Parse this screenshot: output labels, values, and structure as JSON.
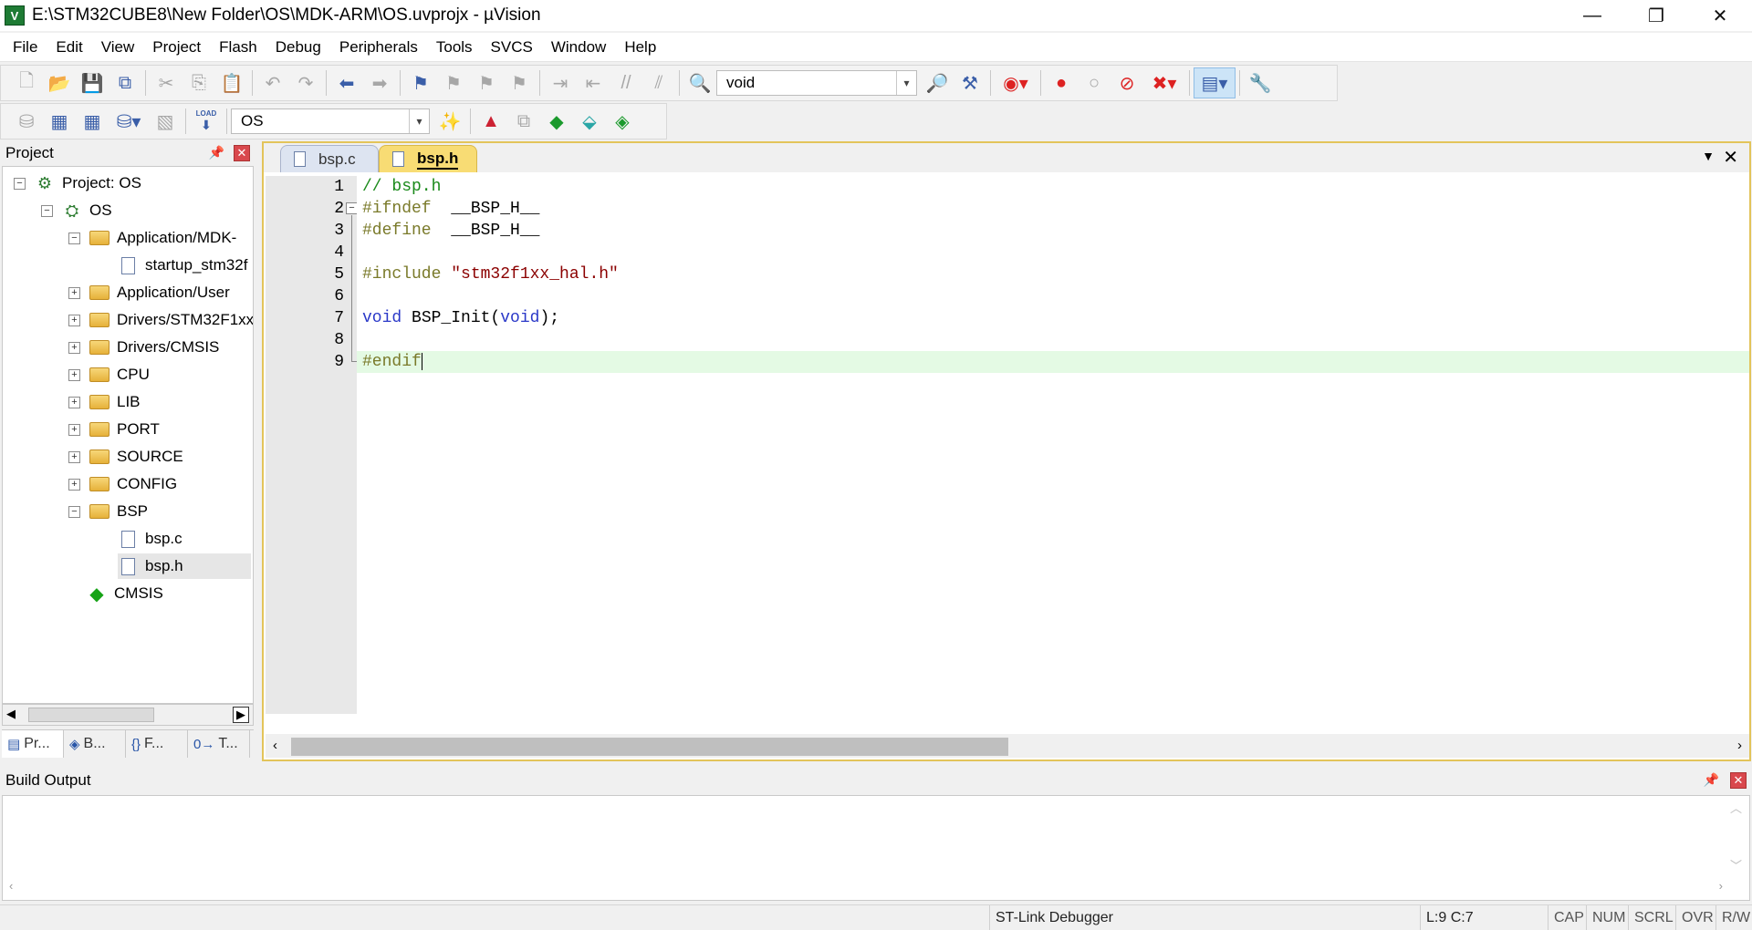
{
  "window": {
    "title": "E:\\STM32CUBE8\\New Folder\\OS\\MDK-ARM\\OS.uvprojx - µVision",
    "app_icon": "V",
    "minimize": "—",
    "restore": "❐",
    "close": "✕"
  },
  "menu": [
    "File",
    "Edit",
    "View",
    "Project",
    "Flash",
    "Debug",
    "Peripherals",
    "Tools",
    "SVCS",
    "Window",
    "Help"
  ],
  "toolbar1": {
    "find_combo_value": "void"
  },
  "toolbar2": {
    "load_label": "LOAD",
    "target_combo_value": "OS"
  },
  "project_panel": {
    "title": "Project",
    "tree": [
      {
        "label": "Project: OS",
        "level": 0,
        "toggle": "−",
        "icon": "target"
      },
      {
        "label": "OS",
        "level": 1,
        "toggle": "−",
        "icon": "target"
      },
      {
        "label": "Application/MDK-",
        "level": 2,
        "toggle": "−",
        "icon": "folder"
      },
      {
        "label": "startup_stm32f",
        "level": 3,
        "toggle": "",
        "icon": "file"
      },
      {
        "label": "Application/User",
        "level": 2,
        "toggle": "+",
        "icon": "folder"
      },
      {
        "label": "Drivers/STM32F1xx",
        "level": 2,
        "toggle": "+",
        "icon": "folder"
      },
      {
        "label": "Drivers/CMSIS",
        "level": 2,
        "toggle": "+",
        "icon": "folder"
      },
      {
        "label": "CPU",
        "level": 2,
        "toggle": "+",
        "icon": "folder"
      },
      {
        "label": "LIB",
        "level": 2,
        "toggle": "+",
        "icon": "folder"
      },
      {
        "label": "PORT",
        "level": 2,
        "toggle": "+",
        "icon": "folder"
      },
      {
        "label": "SOURCE",
        "level": 2,
        "toggle": "+",
        "icon": "folder"
      },
      {
        "label": "CONFIG",
        "level": 2,
        "toggle": "+",
        "icon": "folder"
      },
      {
        "label": "BSP",
        "level": 2,
        "toggle": "−",
        "icon": "folder"
      },
      {
        "label": "bsp.c",
        "level": 3,
        "toggle": "",
        "icon": "file"
      },
      {
        "label": "bsp.h",
        "level": 3,
        "toggle": "",
        "icon": "file",
        "selected": true
      },
      {
        "label": "CMSIS",
        "level": 2,
        "toggle": "",
        "icon": "gem"
      }
    ],
    "bottom_tabs": [
      {
        "icon": "project-icon",
        "glyph": "▤",
        "label": "Pr..."
      },
      {
        "icon": "books-icon",
        "glyph": "◈",
        "label": "B..."
      },
      {
        "icon": "functions-icon",
        "glyph": "{}",
        "label": "F..."
      },
      {
        "icon": "templates-icon",
        "glyph": "0→",
        "label": "T..."
      }
    ]
  },
  "editor": {
    "tabs": [
      {
        "label": "bsp.c",
        "active": false
      },
      {
        "label": "bsp.h",
        "active": true
      }
    ],
    "lines": [
      {
        "n": "1",
        "parts": [
          {
            "t": "// bsp.h",
            "c": "comment"
          }
        ]
      },
      {
        "n": "2",
        "parts": [
          {
            "t": "#ifndef  ",
            "c": "pre"
          },
          {
            "t": "__BSP_H__",
            "c": "plain"
          }
        ]
      },
      {
        "n": "3",
        "parts": [
          {
            "t": "#define  ",
            "c": "pre"
          },
          {
            "t": "__BSP_H__",
            "c": "plain"
          }
        ]
      },
      {
        "n": "4",
        "parts": []
      },
      {
        "n": "5",
        "parts": [
          {
            "t": "#include ",
            "c": "pre"
          },
          {
            "t": "\"stm32f1xx_hal.h\"",
            "c": "str"
          }
        ]
      },
      {
        "n": "6",
        "parts": []
      },
      {
        "n": "7",
        "parts": [
          {
            "t": "void",
            "c": "kw"
          },
          {
            "t": " BSP_Init(",
            "c": "plain"
          },
          {
            "t": "void",
            "c": "kw"
          },
          {
            "t": ");",
            "c": "plain"
          }
        ]
      },
      {
        "n": "8",
        "parts": []
      },
      {
        "n": "9",
        "parts": [
          {
            "t": "#endif",
            "c": "pre"
          }
        ],
        "current": true
      }
    ],
    "colors": {
      "comment": "#1a8a1a",
      "pre": "#7a7a2a",
      "keyword": "#2a38c8",
      "string": "#8b0000",
      "current_line": "#e4fae4"
    }
  },
  "build_output": {
    "title": "Build Output"
  },
  "status": {
    "debugger": "ST-Link Debugger",
    "position": "L:9 C:7",
    "cap": "CAP",
    "num": "NUM",
    "scrl": "SCRL",
    "ovr": "OVR",
    "rw": "R/W"
  }
}
